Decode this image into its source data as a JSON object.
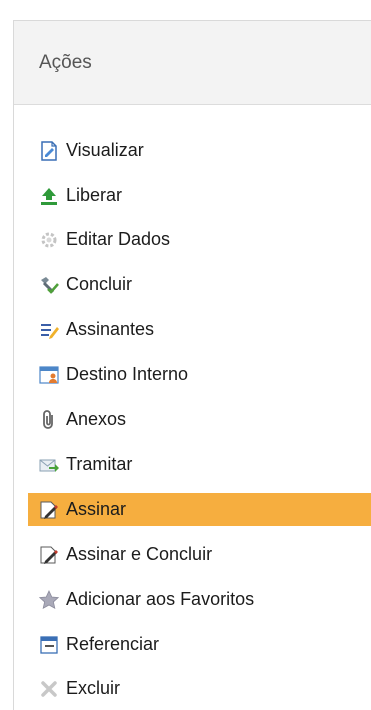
{
  "panel": {
    "title": "Ações",
    "items": [
      {
        "label": "Visualizar",
        "icon": "document-edit-icon"
      },
      {
        "label": "Liberar",
        "icon": "upload-arrow-icon"
      },
      {
        "label": "Editar Dados",
        "icon": "gear-icon"
      },
      {
        "label": "Concluir",
        "icon": "tools-check-icon"
      },
      {
        "label": "Assinantes",
        "icon": "pen-list-icon"
      },
      {
        "label": "Destino Interno",
        "icon": "calendar-user-icon"
      },
      {
        "label": "Anexos",
        "icon": "paperclip-icon"
      },
      {
        "label": "Tramitar",
        "icon": "send-envelope-icon"
      },
      {
        "label": "Assinar",
        "icon": "sign-document-icon",
        "active": true
      },
      {
        "label": "Assinar e Concluir",
        "icon": "sign-document-icon"
      },
      {
        "label": "Adicionar aos Favoritos",
        "icon": "star-icon"
      },
      {
        "label": "Referenciar",
        "icon": "window-reference-icon"
      },
      {
        "label": "Excluir",
        "icon": "delete-x-icon"
      }
    ]
  },
  "colors": {
    "active_background": "#f6ae3f",
    "header_background": "#f3f3f3",
    "text": "#1c1c1c"
  }
}
